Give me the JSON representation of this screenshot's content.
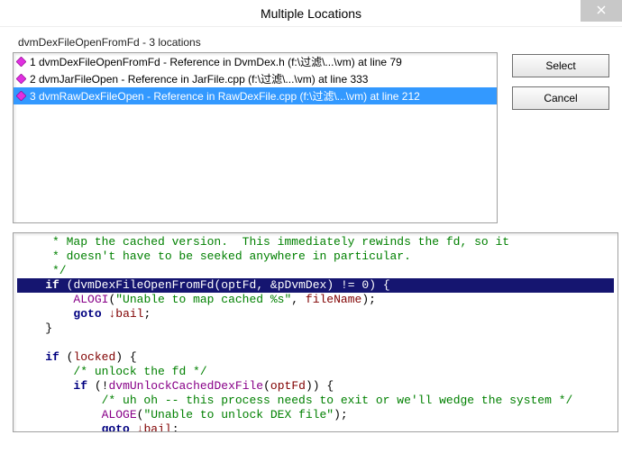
{
  "window": {
    "title": "Multiple Locations"
  },
  "header": {
    "subtitle": "dvmDexFileOpenFromFd - 3 locations"
  },
  "buttons": {
    "select": "Select",
    "cancel": "Cancel"
  },
  "list": {
    "items": [
      {
        "label": "1 dvmDexFileOpenFromFd - Reference in DvmDex.h (f:\\过滤\\...\\vm) at line 79",
        "selected": false
      },
      {
        "label": "2 dvmJarFileOpen - Reference in JarFile.cpp (f:\\过滤\\...\\vm) at line 333",
        "selected": false
      },
      {
        "label": "3 dvmRawDexFileOpen - Reference in RawDexFile.cpp (f:\\过滤\\...\\vm) at line 212",
        "selected": true
      }
    ]
  },
  "code": {
    "c1a": "     * Map the cached version.  This immediately rewinds the fd, so it",
    "c1b": "     * doesn't have to be seeked anywhere in particular.",
    "c1c": "     */",
    "kw_if": "if",
    "fn_open": "dvmDexFileOpenFromFd",
    "v_optFd": "optFd",
    "v_pDvmDex": "&pDvmDex",
    "op_ne": "!= 0",
    "fn_alogi": "ALOGI",
    "str_map": "\"Unable to map cached %s\"",
    "v_fileName": "fileName",
    "kw_goto": "goto",
    "lbl_bail": "bail",
    "v_locked": "locked",
    "c_unlock": "/* unlock the fd */",
    "fn_unlock": "dvmUnlockCachedDexFile",
    "bang": "!",
    "c_uhoh": "/* uh oh -- this process needs to exit or we'll wedge the system */",
    "fn_aloge": "ALOGE",
    "str_dex": "\"Unable to unlock DEX file\"",
    "arrow": "↓"
  }
}
